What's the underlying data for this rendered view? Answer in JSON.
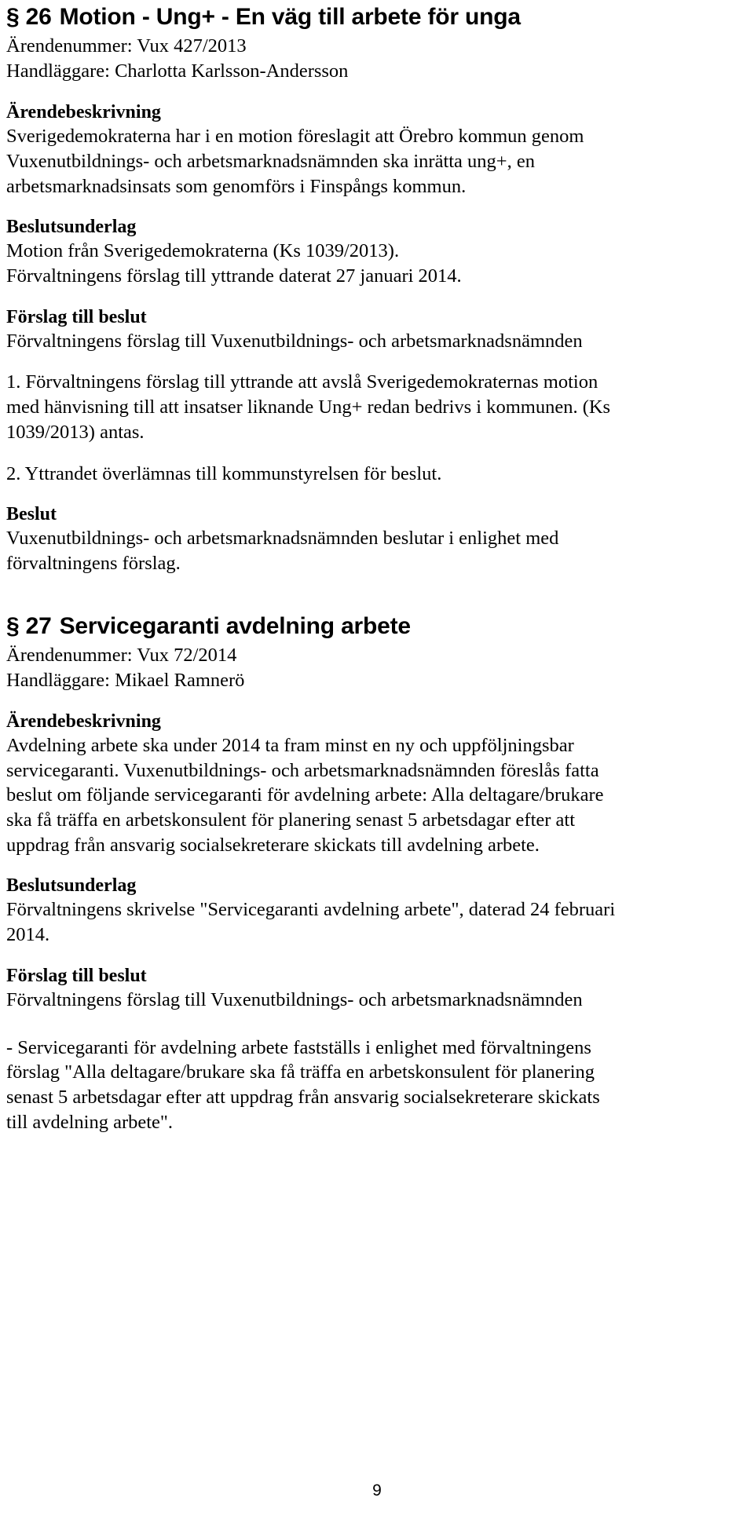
{
  "document": {
    "page_number": "9"
  },
  "sections": [
    {
      "id": "26",
      "number_label": "§ 26",
      "title": "Motion - Ung+ - En väg till arbete för unga",
      "case_number": "Ärendenummer: Vux 427/2013",
      "handler": "Handläggare: Charlotta Karlsson-Andersson",
      "blocks": [
        {
          "heading": "Ärendebeskrivning",
          "paragraphs": [
            "Sverigedemokraterna har i en motion föreslagit att Örebro kommun genom Vuxenutbildnings- och arbetsmarknadsnämnden ska inrätta ung+, en arbetsmarknadsinsats som genomförs i Finspångs kommun."
          ]
        },
        {
          "heading": "Beslutsunderlag",
          "paragraphs": [
            "Motion från Sverigedemokraterna (Ks 1039/2013).\nFörvaltningens förslag till yttrande daterat 27 januari 2014."
          ]
        },
        {
          "heading": "Förslag till beslut",
          "paragraphs": [
            "Förvaltningens förslag till Vuxenutbildnings- och arbetsmarknadsnämnden",
            "1. Förvaltningens förslag till yttrande att avslå Sverigedemokraternas motion med hänvisning till att insatser liknande Ung+ redan bedrivs i kommunen. (Ks 1039/2013) antas.",
            "2. Yttrandet överlämnas till kommunstyrelsen för beslut."
          ]
        },
        {
          "heading": "Beslut",
          "paragraphs": [
            "Vuxenutbildnings- och arbetsmarknadsnämnden beslutar i enlighet med förvaltningens förslag."
          ]
        }
      ]
    },
    {
      "id": "27",
      "number_label": "§ 27",
      "title": "Servicegaranti avdelning arbete",
      "case_number": "Ärendenummer: Vux 72/2014",
      "handler": "Handläggare: Mikael Ramnerö",
      "blocks": [
        {
          "heading": "Ärendebeskrivning",
          "paragraphs": [
            "Avdelning arbete ska under 2014 ta fram minst en ny och uppföljningsbar servicegaranti. Vuxenutbildnings- och arbetsmarknadsnämnden föreslås fatta beslut om följande servicegaranti för avdelning arbete: Alla deltagare/brukare ska få träffa en arbetskonsulent för planering senast 5 arbetsdagar efter att uppdrag från ansvarig socialsekreterare skickats till avdelning arbete."
          ]
        },
        {
          "heading": "Beslutsunderlag",
          "paragraphs": [
            "Förvaltningens skrivelse \"Servicegaranti avdelning arbete\", daterad 24 februari 2014."
          ]
        },
        {
          "heading": "Förslag till beslut",
          "paragraphs": [
            "Förvaltningens förslag till Vuxenutbildnings- och arbetsmarknadsnämnden",
            "- Servicegaranti för avdelning arbete fastställs i enlighet med förvaltningens förslag \"Alla deltagare/brukare ska få träffa en arbetskonsulent för planering senast 5 arbetsdagar efter att uppdrag från ansvarig socialsekreterare skickats till avdelning arbete\"."
          ]
        }
      ]
    }
  ]
}
